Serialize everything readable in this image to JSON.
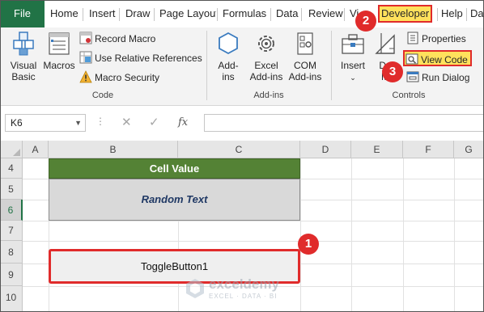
{
  "tabs": {
    "file": "File",
    "items": [
      "Home",
      "Insert",
      "Draw",
      "Page Layout",
      "Formulas",
      "Data",
      "Review",
      "Vi",
      "Developer",
      "Help",
      "Da"
    ],
    "active": "Developer"
  },
  "ribbon": {
    "code": {
      "visual_basic": [
        "Visual",
        "Basic"
      ],
      "macros": "Macros",
      "record_macro": "Record Macro",
      "relative_refs": "Use Relative References",
      "macro_security": "Macro Security",
      "label": "Code"
    },
    "addins": {
      "addins": [
        "Add-",
        "ins"
      ],
      "excel_addins": [
        "Excel",
        "Add-ins"
      ],
      "com_addins": [
        "COM",
        "Add-ins"
      ],
      "label": "Add-ins"
    },
    "controls": {
      "insert": "Insert",
      "design_mode": [
        "De",
        "M"
      ],
      "properties": "Properties",
      "view_code": "View Code",
      "run_dialog": "Run Dialog",
      "label": "Controls"
    }
  },
  "formula_bar": {
    "name_box": "K6",
    "fx": "fx",
    "value": ""
  },
  "sheet": {
    "columns": [
      "A",
      "B",
      "C",
      "D",
      "E",
      "F",
      "G"
    ],
    "rows": [
      "4",
      "5",
      "6",
      "7",
      "8",
      "9",
      "10"
    ],
    "active_row": "6",
    "header_cell": "Cell Value",
    "value_cell": "Random Text",
    "toggle_button": "ToggleButton1"
  },
  "watermark": {
    "name": "exceldemy",
    "tagline": "EXCEL · DATA · BI"
  },
  "badges": [
    "1",
    "2",
    "3"
  ],
  "colors": {
    "excel_green": "#217346",
    "header_fill": "#548235",
    "value_fill": "#d9d9d9",
    "value_text": "#1f3864",
    "highlight": "#ffe15c",
    "annotation_red": "#e02b2b"
  }
}
